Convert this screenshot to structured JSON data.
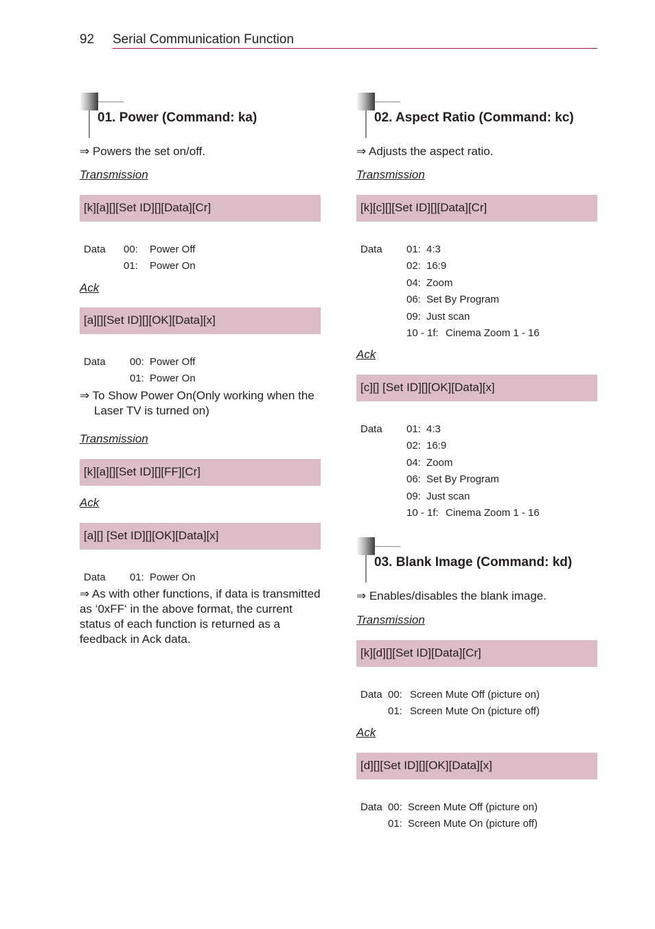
{
  "header": {
    "page_number": "92",
    "title": "Serial Communication Function",
    "rule_color": "#a5135b"
  },
  "colors": {
    "command_box_bg": "#dcbcc6",
    "text": "#231f20"
  },
  "sections": [
    {
      "title": "01. Power (Command: ka)",
      "description": "⇒ Powers the set on/off.",
      "transmission_label": "Transmission",
      "transmission": "[k][a][][Set ID][][Data][Cr]",
      "data_label": "Data",
      "data": [
        {
          "code": "00:",
          "value": "Power Off"
        },
        {
          "code": "01:",
          "value": "Power On"
        }
      ],
      "ack_label": "Ack",
      "ack": "[a][][Set ID][][OK][Data][x]",
      "ack_data_label": "Data",
      "ack_data": [
        {
          "code": "00:",
          "value": "Power Off"
        },
        {
          "code": "01:",
          "value": "Power On"
        }
      ],
      "note1": "⇒ To Show Power On(Only working when the Laser TV is turned on)",
      "transmission2_label": "Transmission",
      "transmission2": "[k][a][][Set ID][][FF][Cr]",
      "ack2_label": "Ack",
      "ack2": "[a][] [Set ID][][OK][Data][x]",
      "ack2_data_label": "Data",
      "ack2_data": [
        {
          "code": "01:",
          "value": "Power On"
        }
      ],
      "note2": "⇒ As with other functions, if data is transmitted as ‘0xFF‘ in the above format, the current status of each function is returned as a feedback in Ack data."
    },
    {
      "title": "02. Aspect Ratio (Command: kc)",
      "description": "⇒ Adjusts the aspect ratio.",
      "transmission_label": "Transmission",
      "transmission": "[k][c][][Set ID][][Data][Cr]",
      "data_label": "Data",
      "data": [
        {
          "code": "01:",
          "value": "4:3"
        },
        {
          "code": "02:",
          "value": "16:9"
        },
        {
          "code": "04:",
          "value": "Zoom"
        },
        {
          "code": "06:",
          "value": "Set By Program"
        },
        {
          "code": "09:",
          "value": "Just scan"
        },
        {
          "code": "10 - 1f:",
          "value": "Cinema Zoom 1 - 16"
        }
      ],
      "ack_label": "Ack",
      "ack": "[c][] [Set ID][][OK][Data][x]",
      "ack_data_label": "Data",
      "ack_data": [
        {
          "code": "01:",
          "value": "4:3"
        },
        {
          "code": "02:",
          "value": "16:9"
        },
        {
          "code": "04:",
          "value": "Zoom"
        },
        {
          "code": "06:",
          "value": "Set By Program"
        },
        {
          "code": "09:",
          "value": "Just scan"
        },
        {
          "code": "10 - 1f:",
          "value": "Cinema Zoom 1 - 16"
        }
      ]
    },
    {
      "title": "03. Blank Image (Command: kd)",
      "description": "⇒ Enables/disables the blank image.",
      "transmission_label": "Transmission",
      "transmission": "[k][d][][Set ID][Data][Cr]",
      "data_label": "Data",
      "data": [
        {
          "code": "00:",
          "value": "Screen Mute Off (picture on)"
        },
        {
          "code": "01:",
          "value": "Screen Mute On (picture off)"
        }
      ],
      "ack_label": "Ack",
      "ack": "[d][][Set ID][][OK][Data][x]",
      "ack_data_label": "Data",
      "ack_data": [
        {
          "code": "00:",
          "value": "Screen Mute Off (picture on)"
        },
        {
          "code": "01:",
          "value": "Screen Mute On (picture off)"
        }
      ]
    }
  ]
}
